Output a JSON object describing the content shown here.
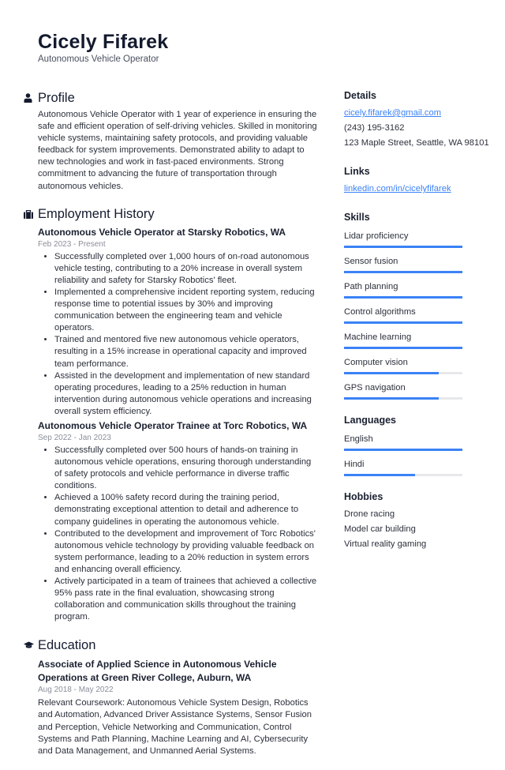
{
  "header": {
    "name": "Cicely Fifarek",
    "title": "Autonomous Vehicle Operator"
  },
  "profile": {
    "heading": "Profile",
    "icon": "person-icon",
    "text": "Autonomous Vehicle Operator with 1 year of experience in ensuring the safe and efficient operation of self-driving vehicles. Skilled in monitoring vehicle systems, maintaining safety protocols, and providing valuable feedback for system improvements. Demonstrated ability to adapt to new technologies and work in fast-paced environments. Strong commitment to advancing the future of transportation through autonomous vehicles."
  },
  "employment": {
    "heading": "Employment History",
    "icon": "briefcase-icon",
    "jobs": [
      {
        "title": "Autonomous Vehicle Operator at Starsky Robotics, WA",
        "dates": "Feb 2023 - Present",
        "bullets": [
          "Successfully completed over 1,000 hours of on-road autonomous vehicle testing, contributing to a 20% increase in overall system reliability and safety for Starsky Robotics' fleet.",
          "Implemented a comprehensive incident reporting system, reducing response time to potential issues by 30% and improving communication between the engineering team and vehicle operators.",
          "Trained and mentored five new autonomous vehicle operators, resulting in a 15% increase in operational capacity and improved team performance.",
          "Assisted in the development and implementation of new standard operating procedures, leading to a 25% reduction in human intervention during autonomous vehicle operations and increasing overall system efficiency."
        ]
      },
      {
        "title": "Autonomous Vehicle Operator Trainee at Torc Robotics, WA",
        "dates": "Sep 2022 - Jan 2023",
        "bullets": [
          "Successfully completed over 500 hours of hands-on training in autonomous vehicle operations, ensuring thorough understanding of safety protocols and vehicle performance in diverse traffic conditions.",
          "Achieved a 100% safety record during the training period, demonstrating exceptional attention to detail and adherence to company guidelines in operating the autonomous vehicle.",
          "Contributed to the development and improvement of Torc Robotics' autonomous vehicle technology by providing valuable feedback on system performance, leading to a 20% reduction in system errors and enhancing overall efficiency.",
          "Actively participated in a team of trainees that achieved a collective 95% pass rate in the final evaluation, showcasing strong collaboration and communication skills throughout the training program."
        ]
      }
    ]
  },
  "education": {
    "heading": "Education",
    "icon": "graduation-cap-icon",
    "entries": [
      {
        "title": "Associate of Applied Science in Autonomous Vehicle Operations at Green River College, Auburn, WA",
        "dates": "Aug 2018 - May 2022",
        "text": "Relevant Coursework: Autonomous Vehicle System Design, Robotics and Automation, Advanced Driver Assistance Systems, Sensor Fusion and Perception, Vehicle Networking and Communication, Control Systems and Path Planning, Machine Learning and AI, Cybersecurity and Data Management, and Unmanned Aerial Systems."
      }
    ]
  },
  "details": {
    "heading": "Details",
    "email": "cicely.fifarek@gmail.com",
    "phone": "(243) 195-3162",
    "address": "123 Maple Street, Seattle, WA 98101"
  },
  "links": {
    "heading": "Links",
    "items": [
      "linkedin.com/in/cicelyfifarek"
    ]
  },
  "skills": {
    "heading": "Skills",
    "items": [
      {
        "label": "Lidar proficiency",
        "level": 1.0
      },
      {
        "label": "Sensor fusion",
        "level": 1.0
      },
      {
        "label": "Path planning",
        "level": 1.0
      },
      {
        "label": "Control algorithms",
        "level": 1.0
      },
      {
        "label": "Machine learning",
        "level": 1.0
      },
      {
        "label": "Computer vision",
        "level": 0.8
      },
      {
        "label": "GPS navigation",
        "level": 0.8
      }
    ]
  },
  "languages": {
    "heading": "Languages",
    "items": [
      {
        "label": "English",
        "level": 1.0
      },
      {
        "label": "Hindi",
        "level": 0.6
      }
    ]
  },
  "hobbies": {
    "heading": "Hobbies",
    "items": [
      "Drone racing",
      "Model car building",
      "Virtual reality gaming"
    ]
  },
  "colors": {
    "accent": "#3b82f6",
    "bar_track": "#e6e8eb",
    "text": "#2b303b",
    "muted": "#8a8f99"
  }
}
